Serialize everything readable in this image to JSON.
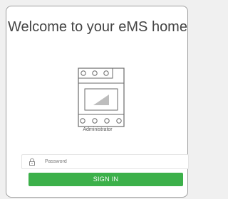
{
  "login": {
    "title": "Welcome to your eMS home",
    "user_role": "Administrator",
    "password_placeholder": "Password",
    "password_value": "",
    "submit_label": "SIGN IN"
  },
  "icons": {
    "device": "energy-meter-icon",
    "lock": "lock-icon"
  },
  "colors": {
    "accent": "#3cb04a",
    "card_border": "#9e9e9e",
    "title_text": "#444444"
  }
}
